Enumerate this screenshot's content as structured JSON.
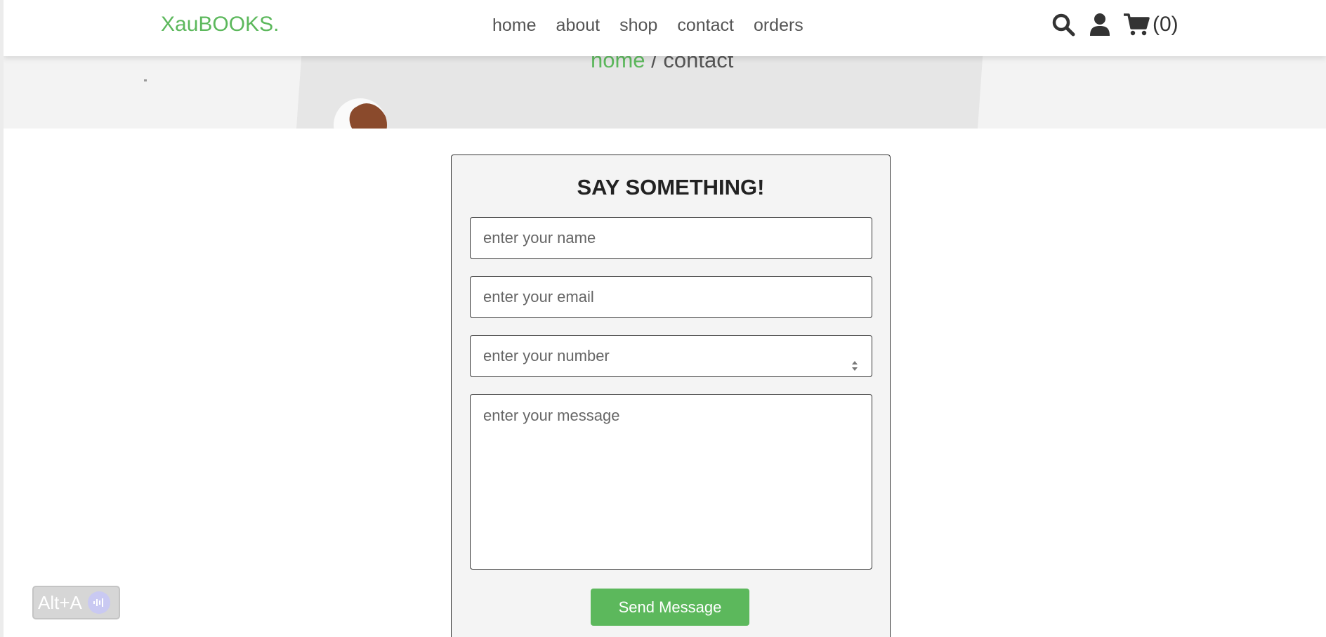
{
  "header": {
    "logo": "XauBOOKS.",
    "nav": [
      "home",
      "about",
      "shop",
      "contact",
      "orders"
    ],
    "cart_count": "(0)"
  },
  "breadcrumb": {
    "home": "home",
    "separator": "/",
    "current": "contact"
  },
  "form": {
    "title": "SAY SOMETHING!",
    "name_placeholder": "enter your name",
    "email_placeholder": "enter your email",
    "number_placeholder": "enter your number",
    "message_placeholder": "enter your message",
    "submit_label": "Send Message"
  },
  "shortcut_badge": {
    "label": "Alt+A"
  },
  "colors": {
    "accent": "#5cb85c",
    "text": "#333333",
    "form_bg": "#f4f4f4"
  },
  "icons": [
    "search-icon",
    "user-icon",
    "cart-icon",
    "microphone-icon"
  ]
}
